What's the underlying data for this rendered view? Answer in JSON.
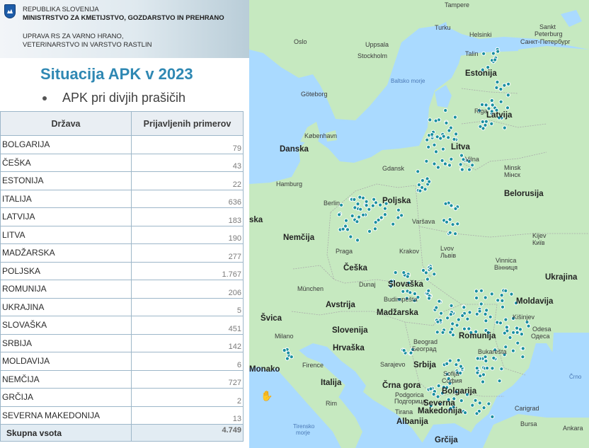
{
  "header": {
    "line1": "REPUBLIKA SLOVENIJA",
    "line2": "MINISTRSTVO ZA KMETIJSTVO, GOZDARSTVO IN PREHRANO",
    "line3": "UPRAVA RS ZA VARNO HRANO,",
    "line4": "VETERINARSTVO IN VARSTVO RASTLIN"
  },
  "slide": {
    "title": "Situacija APK v 2023",
    "subtitle": "APK pri divjih prašičih"
  },
  "table": {
    "headers": [
      "Država",
      "Prijavljenih primerov"
    ],
    "rows": [
      {
        "country": "BOLGARIJA",
        "value": "79"
      },
      {
        "country": "ČEŠKA",
        "value": "43"
      },
      {
        "country": "ESTONIJA",
        "value": "22"
      },
      {
        "country": "ITALIJA",
        "value": "636"
      },
      {
        "country": "LATVIJA",
        "value": "183"
      },
      {
        "country": "LITVA",
        "value": "190"
      },
      {
        "country": "MADŽARSKA",
        "value": "277"
      },
      {
        "country": "POLJSKA",
        "value": "1.767"
      },
      {
        "country": "ROMUNIJA",
        "value": "206"
      },
      {
        "country": "UKRAJINA",
        "value": "5"
      },
      {
        "country": "SLOVAŠKA",
        "value": "451"
      },
      {
        "country": "SRBIJA",
        "value": "142"
      },
      {
        "country": "MOLDAVIJA",
        "value": "6"
      },
      {
        "country": "NEMČIJA",
        "value": "727"
      },
      {
        "country": "GRČIJA",
        "value": "2"
      },
      {
        "country": "SEVERNA MAKEDONIJA",
        "value": "13"
      }
    ],
    "total_label": "Skupna vsota",
    "total_value": "4.749"
  },
  "map": {
    "colors": {
      "water": "#aadaff",
      "land": "#c6e9c0",
      "marker": "#1a8fa0"
    },
    "labels": [
      {
        "id": "tampere",
        "text": "Tampere",
        "kind": "city"
      },
      {
        "id": "turku",
        "text": "Turku",
        "kind": "city"
      },
      {
        "id": "helsinki",
        "text": "Helsinki",
        "kind": "city"
      },
      {
        "id": "sankt",
        "text": "Sankt",
        "kind": "city"
      },
      {
        "id": "peterburg",
        "text": "Peterburg",
        "kind": "city"
      },
      {
        "id": "sankt-ru",
        "text": "Санкт-Петербург",
        "kind": "city"
      },
      {
        "id": "oslo",
        "text": "Oslo",
        "kind": "city"
      },
      {
        "id": "uppsala",
        "text": "Uppsala",
        "kind": "city"
      },
      {
        "id": "stockholm",
        "text": "Stockholm",
        "kind": "city"
      },
      {
        "id": "talin",
        "text": "Talin",
        "kind": "city"
      },
      {
        "id": "estonija",
        "text": "Estonija",
        "kind": "country"
      },
      {
        "id": "baltsko",
        "text": "Baltsko morje",
        "kind": "sea"
      },
      {
        "id": "goteborg",
        "text": "Göteborg",
        "kind": "city"
      },
      {
        "id": "riga",
        "text": "Riga",
        "kind": "city"
      },
      {
        "id": "latvija",
        "text": "Latvija",
        "kind": "country"
      },
      {
        "id": "kobenhavn",
        "text": "København",
        "kind": "city"
      },
      {
        "id": "danska",
        "text": "Danska",
        "kind": "country"
      },
      {
        "id": "litva",
        "text": "Litva",
        "kind": "country"
      },
      {
        "id": "vilna",
        "text": "Vilna",
        "kind": "city"
      },
      {
        "id": "gdansk",
        "text": "Gdansk",
        "kind": "city"
      },
      {
        "id": "minsk",
        "text": "Minsk",
        "kind": "city"
      },
      {
        "id": "minsk-ru",
        "text": "Мінск",
        "kind": "city"
      },
      {
        "id": "hamburg",
        "text": "Hamburg",
        "kind": "city"
      },
      {
        "id": "belorusija",
        "text": "Belorusija",
        "kind": "country"
      },
      {
        "id": "berlin",
        "text": "Berlin",
        "kind": "city"
      },
      {
        "id": "poljska",
        "text": "Poljska",
        "kind": "country"
      },
      {
        "id": "ska",
        "text": "ska",
        "kind": "country"
      },
      {
        "id": "varsava",
        "text": "Varšava",
        "kind": "city"
      },
      {
        "id": "nemcija",
        "text": "Nemčija",
        "kind": "country"
      },
      {
        "id": "kijev",
        "text": "Kijev",
        "kind": "city"
      },
      {
        "id": "kijev-ua",
        "text": "Київ",
        "kind": "city"
      },
      {
        "id": "praga",
        "text": "Praga",
        "kind": "city"
      },
      {
        "id": "krakov",
        "text": "Krakov",
        "kind": "city"
      },
      {
        "id": "lvov",
        "text": "Lvov",
        "kind": "city"
      },
      {
        "id": "lvov-ua",
        "text": "Львів",
        "kind": "city"
      },
      {
        "id": "vinnica",
        "text": "Vinnica",
        "kind": "city"
      },
      {
        "id": "vinnica-ua",
        "text": "Вінниця",
        "kind": "city"
      },
      {
        "id": "ceska",
        "text": "Češka",
        "kind": "country"
      },
      {
        "id": "ukrajina",
        "text": "Ukrajina",
        "kind": "country"
      },
      {
        "id": "dunaj",
        "text": "Dunaj",
        "kind": "city"
      },
      {
        "id": "munchen",
        "text": "München",
        "kind": "city"
      },
      {
        "id": "slovaska",
        "text": "Slovaška",
        "kind": "country"
      },
      {
        "id": "avstrija",
        "text": "Avstrija",
        "kind": "country"
      },
      {
        "id": "budimpesta",
        "text": "Budimpešta",
        "kind": "city"
      },
      {
        "id": "moldavija",
        "text": "Moldavija",
        "kind": "country"
      },
      {
        "id": "svica",
        "text": "Švica",
        "kind": "country"
      },
      {
        "id": "madzarska",
        "text": "Madžarska",
        "kind": "country"
      },
      {
        "id": "kisinjev",
        "text": "Kišinjev",
        "kind": "city"
      },
      {
        "id": "milano",
        "text": "Milano",
        "kind": "city"
      },
      {
        "id": "slovenija",
        "text": "Slovenija",
        "kind": "country"
      },
      {
        "id": "odesa",
        "text": "Odesa",
        "kind": "city"
      },
      {
        "id": "odesa-ua",
        "text": "Одеса",
        "kind": "city"
      },
      {
        "id": "romunija",
        "text": "Romunija",
        "kind": "country"
      },
      {
        "id": "hrvaska",
        "text": "Hrvaška",
        "kind": "country"
      },
      {
        "id": "beograd",
        "text": "Beograd",
        "kind": "city"
      },
      {
        "id": "beograd-sr",
        "text": "Београд",
        "kind": "city"
      },
      {
        "id": "bukaresta",
        "text": "Bukarešta",
        "kind": "city"
      },
      {
        "id": "monako",
        "text": "Monako",
        "kind": "country"
      },
      {
        "id": "firence",
        "text": "Firence",
        "kind": "city"
      },
      {
        "id": "sarajevo",
        "text": "Sarajevo",
        "kind": "city"
      },
      {
        "id": "srbija",
        "text": "Srbija",
        "kind": "country"
      },
      {
        "id": "sofija",
        "text": "Sofija",
        "kind": "city"
      },
      {
        "id": "sofija-bg",
        "text": "София",
        "kind": "city"
      },
      {
        "id": "crno",
        "text": "Črno",
        "kind": "sea"
      },
      {
        "id": "italija",
        "text": "Italija",
        "kind": "country"
      },
      {
        "id": "crna-gora",
        "text": "Črna gora",
        "kind": "country"
      },
      {
        "id": "bolgarija",
        "text": "Bolgarija",
        "kind": "country"
      },
      {
        "id": "podgorica",
        "text": "Podgorica",
        "kind": "city"
      },
      {
        "id": "podgorica-sr",
        "text": "Подгорица",
        "kind": "city"
      },
      {
        "id": "rim",
        "text": "Rim",
        "kind": "city"
      },
      {
        "id": "severna",
        "text": "Severna",
        "kind": "country"
      },
      {
        "id": "makedonija",
        "text": "Makedonija",
        "kind": "country"
      },
      {
        "id": "tirana",
        "text": "Tirana",
        "kind": "city"
      },
      {
        "id": "carigrad",
        "text": "Carigrad",
        "kind": "city"
      },
      {
        "id": "albanija",
        "text": "Albanija",
        "kind": "country"
      },
      {
        "id": "bursa",
        "text": "Bursa",
        "kind": "city"
      },
      {
        "id": "ankara",
        "text": "Ankara",
        "kind": "city"
      },
      {
        "id": "tirensko",
        "text": "Tirensko",
        "kind": "sea"
      },
      {
        "id": "morje",
        "text": "morje",
        "kind": "sea"
      },
      {
        "id": "grcija",
        "text": "Grčija",
        "kind": "country"
      }
    ]
  }
}
